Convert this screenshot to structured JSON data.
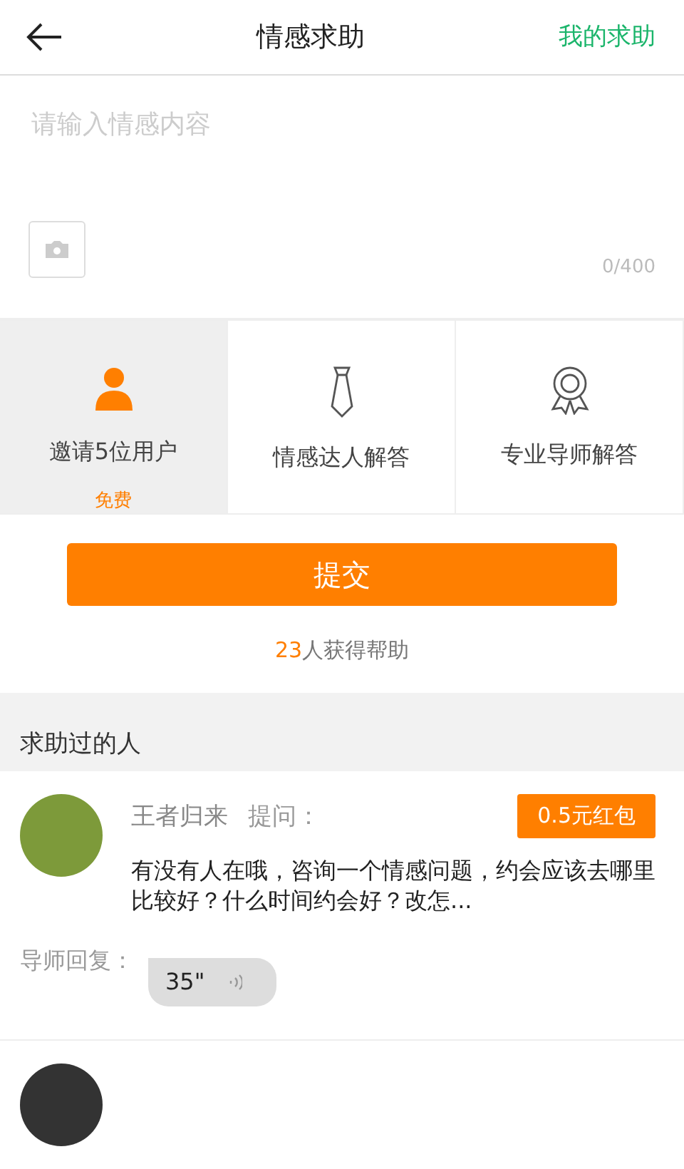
{
  "header": {
    "title": "情感求助",
    "action": "我的求助"
  },
  "input": {
    "placeholder": "请输入情感内容",
    "counter": "0/400"
  },
  "options": [
    {
      "kind": "person",
      "label": "邀请5位用户",
      "note": "免费",
      "selected": true
    },
    {
      "kind": "tie",
      "label": "情感达人解答",
      "selected": false
    },
    {
      "kind": "medal",
      "label": "专业导师解答",
      "selected": false
    }
  ],
  "submit": "提交",
  "helped": {
    "count": "23",
    "text": "人获得帮助"
  },
  "section_title": "求助过的人",
  "posts": [
    {
      "name": "王者归来",
      "ask_label": "提问：",
      "reward": "0.5元红包",
      "question": "有没有人在哦，咨询一个情感问题，约会应该去哪里比较好？什么时间约会好？改怎...",
      "reply_label": "导师回复：",
      "voice_length": "35\""
    }
  ]
}
